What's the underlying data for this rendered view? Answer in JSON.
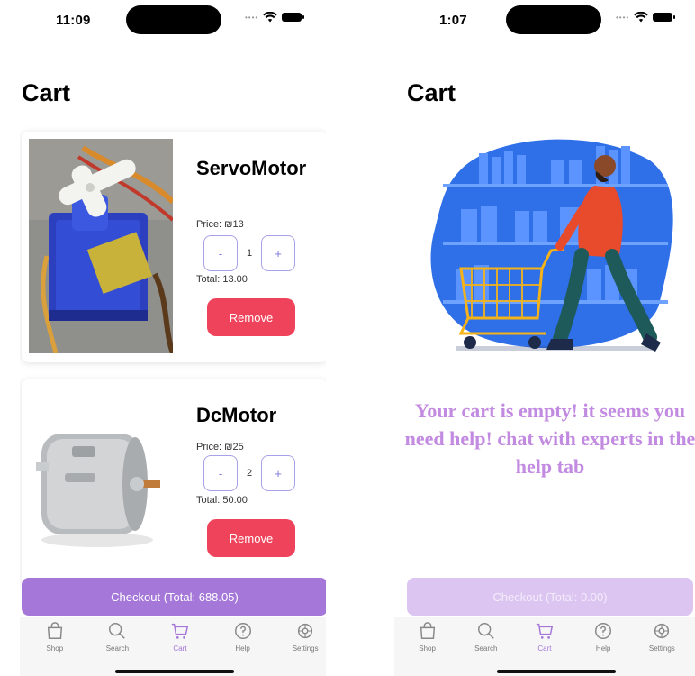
{
  "left_screen": {
    "status_bar": {
      "time": "11:09"
    },
    "title": "Cart",
    "items": [
      {
        "name": "ServoMotor",
        "price": "Price: ₪13",
        "quantity": "1",
        "total": "Total: 13.00",
        "minus": "-",
        "plus": "+",
        "remove": "Remove"
      },
      {
        "name": "DcMotor",
        "price": "Price: ₪25",
        "quantity": "2",
        "total": "Total: 50.00",
        "minus": "-",
        "plus": "+",
        "remove": "Remove"
      }
    ],
    "checkout": "Checkout (Total: 688.05)"
  },
  "right_screen": {
    "status_bar": {
      "time": "1:07"
    },
    "title": "Cart",
    "empty_message": "Your cart is empty! it seems you need help! chat with experts in the help tab",
    "checkout": "Checkout (Total: 0.00)"
  },
  "tabs": [
    {
      "label": "Shop",
      "icon": "shopping-bag-icon"
    },
    {
      "label": "Search",
      "icon": "search-icon"
    },
    {
      "label": "Cart",
      "icon": "cart-icon"
    },
    {
      "label": "Help",
      "icon": "help-icon"
    },
    {
      "label": "Settings",
      "icon": "settings-icon"
    }
  ],
  "colors": {
    "accent": "#a477d9",
    "remove": "#ee435a",
    "stepper_border": "#a7a2e8",
    "empty_text": "#c28ae0",
    "checkout_disabled": "#dcc6f1"
  }
}
